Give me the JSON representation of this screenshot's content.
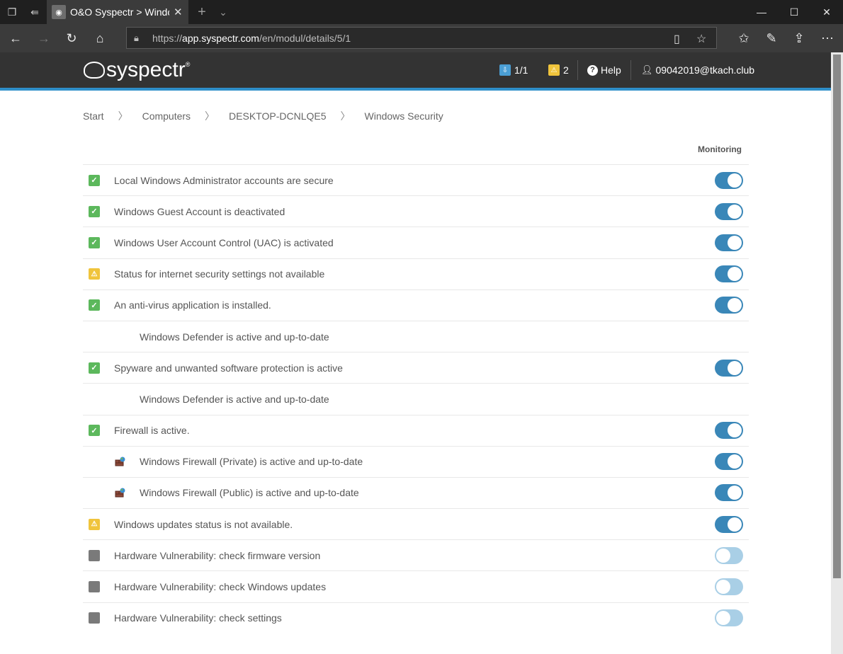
{
  "browser": {
    "tab_title": "O&O Syspectr > Windo",
    "url_prefix": "https://",
    "url_domain": "app.syspectr.com",
    "url_path": "/en/modul/details/5/1"
  },
  "header": {
    "logo": "syspectr",
    "logo_reg": "®",
    "downloads_count": "1/1",
    "warnings_count": "2",
    "help_label": "Help",
    "user_label": "09042019@tkach.club"
  },
  "breadcrumb": [
    "Start",
    "Computers",
    "DESKTOP-DCNLQE5",
    "Windows Security"
  ],
  "monitoring_header": "Monitoring",
  "rows": [
    {
      "status": "ok",
      "label": "Local Windows Administrator accounts are secure",
      "toggle": "on",
      "sub": false
    },
    {
      "status": "ok",
      "label": "Windows Guest Account is deactivated",
      "toggle": "on",
      "sub": false
    },
    {
      "status": "ok",
      "label": "Windows User Account Control (UAC) is activated",
      "toggle": "on",
      "sub": false
    },
    {
      "status": "warn",
      "label": "Status for internet security settings not available",
      "toggle": "on",
      "sub": false
    },
    {
      "status": "ok",
      "label": "An anti-virus application is installed.",
      "toggle": "on",
      "sub": false
    },
    {
      "status": "none",
      "label": "Windows Defender is active and up-to-date",
      "toggle": "none",
      "sub": true
    },
    {
      "status": "ok",
      "label": "Spyware and unwanted software protection is active",
      "toggle": "on",
      "sub": false
    },
    {
      "status": "none",
      "label": "Windows Defender is active and up-to-date",
      "toggle": "none",
      "sub": true
    },
    {
      "status": "ok",
      "label": "Firewall is active.",
      "toggle": "on",
      "sub": false
    },
    {
      "status": "firewall",
      "label": "Windows Firewall (Private) is active and up-to-date",
      "toggle": "on",
      "sub": true
    },
    {
      "status": "firewall",
      "label": "Windows Firewall (Public) is active and up-to-date",
      "toggle": "on",
      "sub": true
    },
    {
      "status": "warn",
      "label": "Windows updates status is not available.",
      "toggle": "on",
      "sub": false
    },
    {
      "status": "off",
      "label": "Hardware Vulnerability: check firmware version",
      "toggle": "off",
      "sub": false
    },
    {
      "status": "off",
      "label": "Hardware Vulnerability: check Windows updates",
      "toggle": "off",
      "sub": false
    },
    {
      "status": "off",
      "label": "Hardware Vulnerability: check settings",
      "toggle": "off",
      "sub": false
    }
  ],
  "colors": {
    "accent": "#2f8fc9",
    "ok": "#5cb85c",
    "warn": "#f0c43c",
    "toggle_on": "#3a87b8",
    "toggle_off": "#a9cfe6"
  }
}
